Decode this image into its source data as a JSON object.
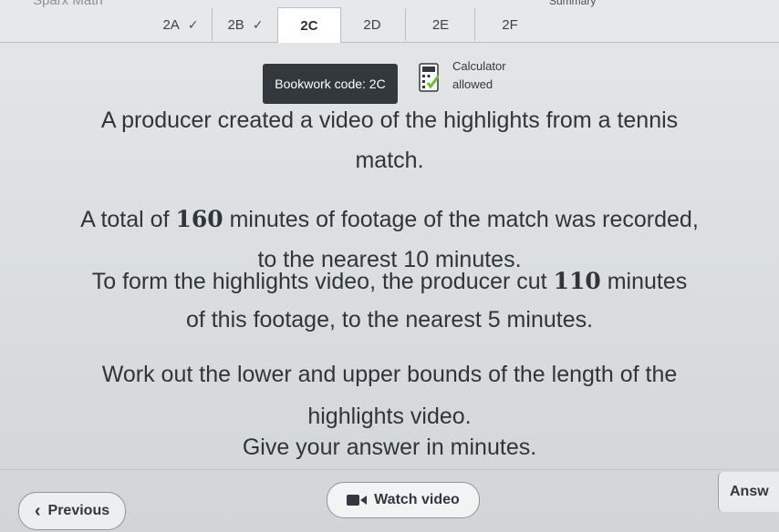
{
  "app": {
    "brand": "Sparx Math"
  },
  "tabs": [
    {
      "label": "2A",
      "completed": true
    },
    {
      "label": "2B",
      "completed": true
    },
    {
      "label": "2C",
      "completed": false,
      "active": true
    },
    {
      "label": "2D",
      "completed": false
    },
    {
      "label": "2E",
      "completed": false
    },
    {
      "label": "2F",
      "completed": false
    },
    {
      "label": "Summary",
      "completed": false
    }
  ],
  "check_glyph": "✓",
  "bookwork": {
    "label": "Bookwork code: 2C"
  },
  "calculator": {
    "line1": "Calculator",
    "line2": "allowed",
    "icon": "calculator-icon"
  },
  "question": {
    "p1": {
      "l1": "A producer created a video of the highlights from a tennis",
      "l2": "match."
    },
    "p2": {
      "l1_pre": "A total of ",
      "l1_num": "160",
      "l1_post": " minutes of footage of the match was recorded,",
      "l2": "to the nearest 10 minutes."
    },
    "p3": {
      "l1_pre": "To form the highlights video, the producer cut ",
      "l1_num": "110",
      "l1_post": " minutes",
      "l2": "of this footage, to the nearest 5 minutes."
    },
    "p4": {
      "l1": "Work out the lower and upper bounds of the length of the",
      "l2": "highlights video.",
      "l3": "Give your answer in minutes."
    }
  },
  "footer": {
    "previous": "Previous",
    "watch_video": "Watch video",
    "answer": "Answ"
  },
  "colors": {
    "bookwork_bg": "#33383c",
    "calc_green": "#6bbd3a"
  }
}
